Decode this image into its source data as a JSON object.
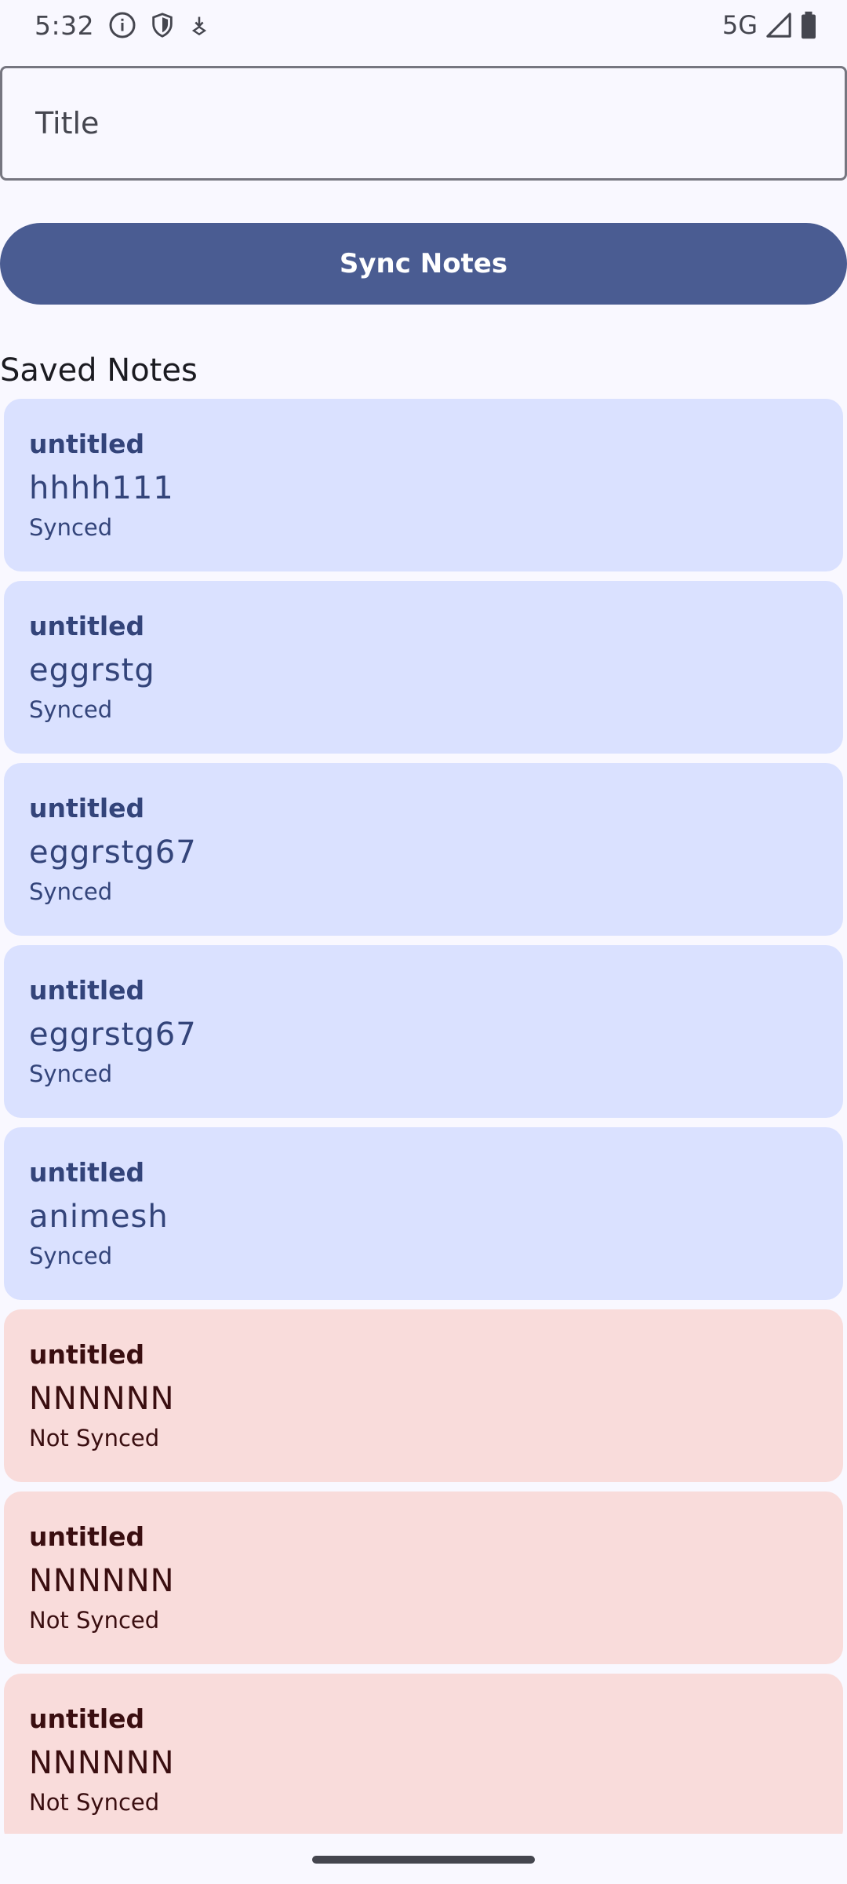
{
  "status_bar": {
    "time": "5:32",
    "network": "5G",
    "icons_left": [
      "info-icon",
      "shield-icon",
      "download-icon"
    ],
    "icons_right": [
      "signal-icon",
      "battery-icon"
    ]
  },
  "title_input": {
    "placeholder": "Title",
    "value": ""
  },
  "sync_button": {
    "label": "Sync Notes"
  },
  "section": {
    "title": "Saved Notes"
  },
  "notes": [
    {
      "title": "untitled",
      "body": "hhhh111",
      "status": "Synced",
      "synced": true
    },
    {
      "title": "untitled",
      "body": "eggrstg",
      "status": "Synced",
      "synced": true
    },
    {
      "title": "untitled",
      "body": "eggrstg67",
      "status": "Synced",
      "synced": true
    },
    {
      "title": "untitled",
      "body": "eggrstg67",
      "status": "Synced",
      "synced": true
    },
    {
      "title": "untitled",
      "body": "animesh",
      "status": "Synced",
      "synced": true
    },
    {
      "title": "untitled",
      "body": "NNNNNN",
      "status": "Not Synced",
      "synced": false
    },
    {
      "title": "untitled",
      "body": "NNNNNN",
      "status": "Not Synced",
      "synced": false
    },
    {
      "title": "untitled",
      "body": "NNNNNN",
      "status": "Not Synced",
      "synced": false
    }
  ],
  "colors": {
    "background": "#f9f8ff",
    "primary": "#4a5c92",
    "synced_card": "#dae1ff",
    "synced_text": "#33447a",
    "unsynced_card": "#f9dcdb",
    "unsynced_text": "#3a0e10"
  }
}
